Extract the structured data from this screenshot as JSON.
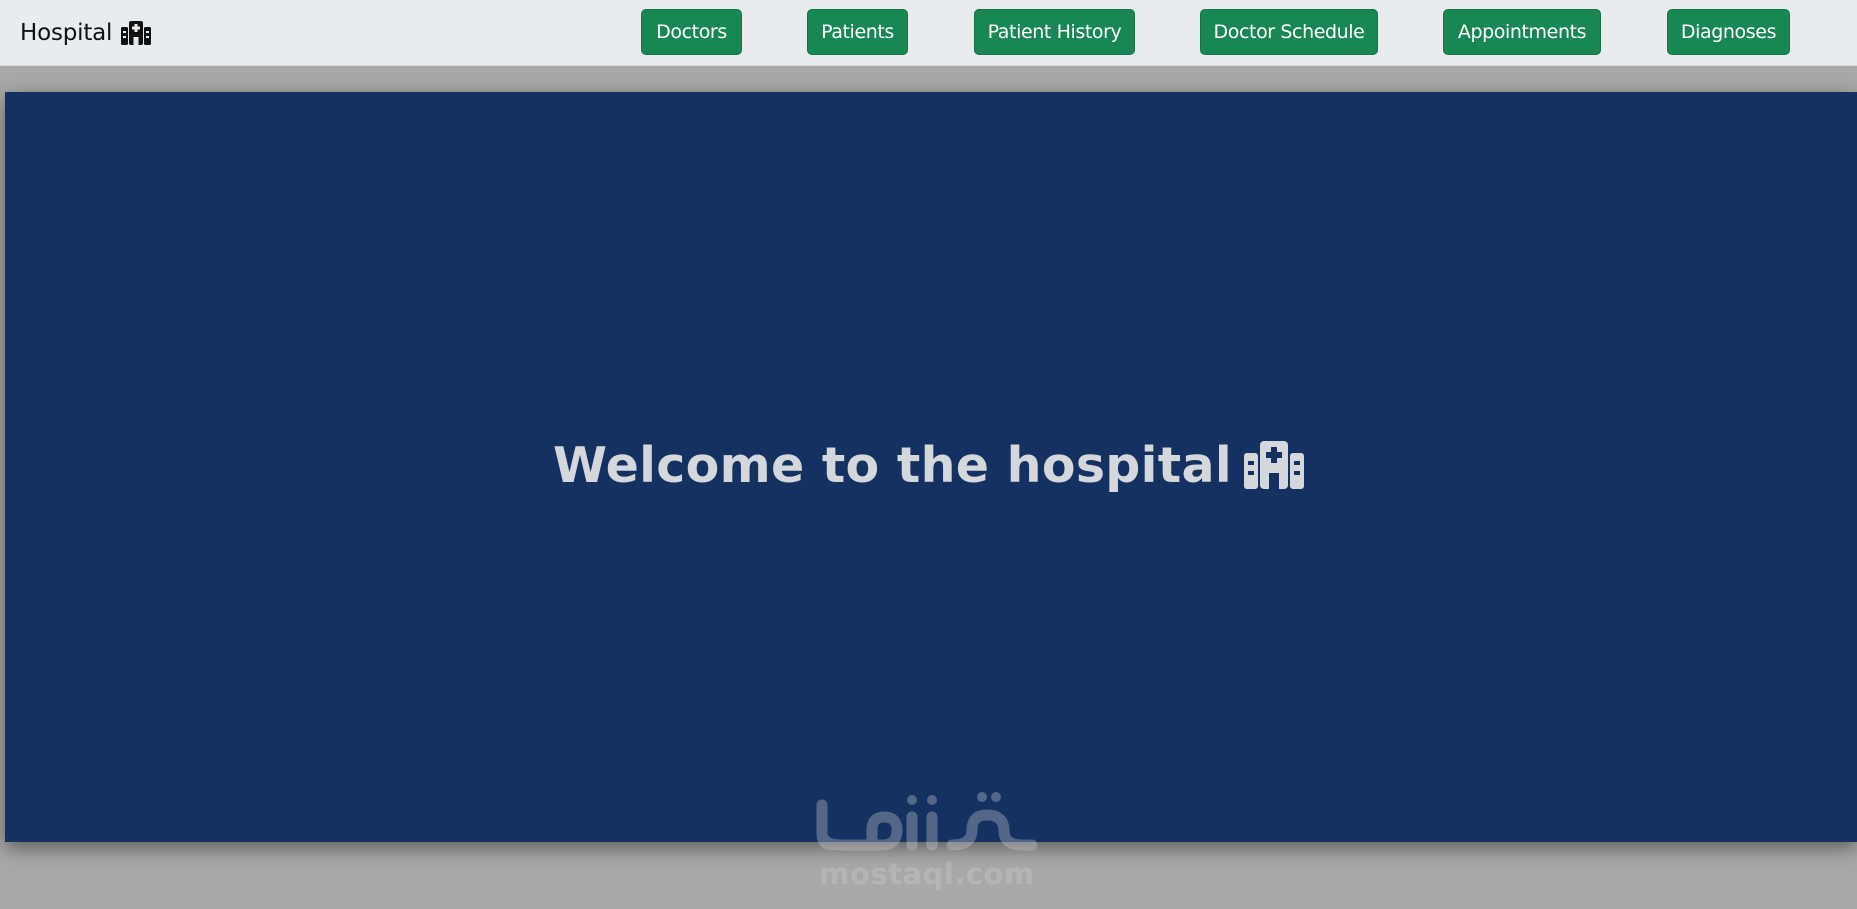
{
  "navbar": {
    "brand_label": "Hospital",
    "brand_icon": "hospital-icon",
    "links": [
      {
        "label": "Doctors"
      },
      {
        "label": "Patients"
      },
      {
        "label": "Patient History"
      },
      {
        "label": "Doctor Schedule"
      },
      {
        "label": "Appointments"
      },
      {
        "label": "Diagnoses"
      }
    ]
  },
  "hero": {
    "title": "Welcome to the hospital",
    "icon": "hospital-icon"
  },
  "watermark": {
    "text": "mostaql.com"
  },
  "colors": {
    "navbar_bg": "#e8ecef",
    "button_green": "#198754",
    "hero_bg": "#153162",
    "page_bg": "#a8a8a8"
  }
}
